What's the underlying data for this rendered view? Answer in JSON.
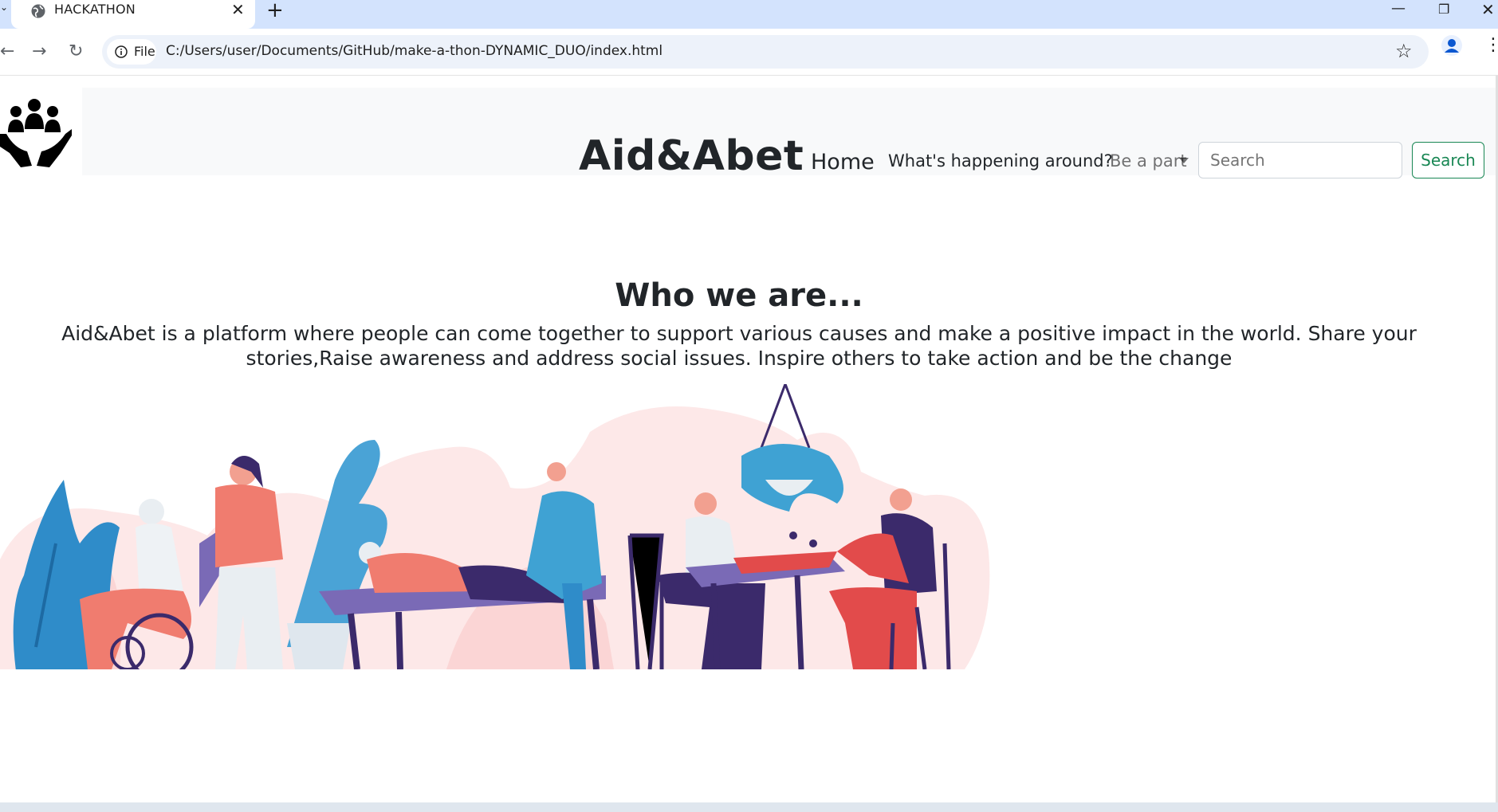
{
  "browser": {
    "tab_title": "HACKATHON",
    "chip_label": "File",
    "url": "C:/Users/user/Documents/GitHub/make-a-thon-DYNAMIC_DUO/index.html",
    "icons": [
      "tab-list-icon",
      "globe-icon",
      "close-icon",
      "plus-icon",
      "minimize-icon",
      "restore-icon",
      "close-window-icon",
      "back-icon",
      "forward-icon",
      "reload-icon",
      "info-icon",
      "star-icon",
      "profile-icon",
      "menu-icon"
    ]
  },
  "navbar": {
    "brand": "Aid&Abet",
    "home": "Home",
    "happening": "What's happening around?",
    "be_a_part": "Be a part",
    "search_placeholder": "Search",
    "search_button": "Search",
    "accent_color": "#198754"
  },
  "content": {
    "heading": "Who we are...",
    "description": "Aid&Abet is a platform where people can come together to support various causes and make a positive impact in the world. Share your stories,Raise awareness and address social issues. Inspire others to take action and be the change"
  }
}
